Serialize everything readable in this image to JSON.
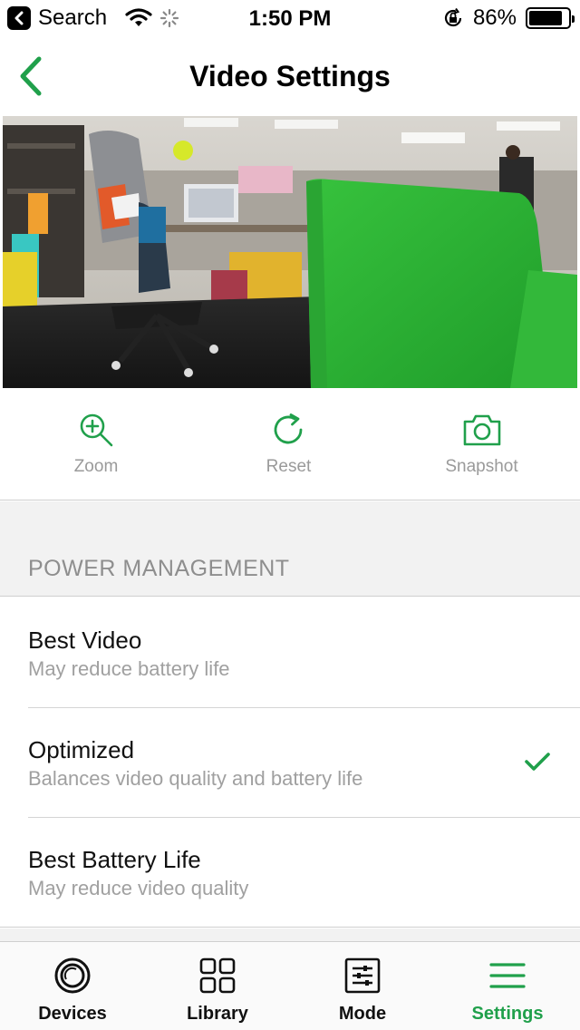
{
  "colors": {
    "accent": "#20a04b",
    "muted_text": "#9a9a9a",
    "section_bg": "#f2f2f2"
  },
  "status_bar": {
    "back_app_label": "Search",
    "time": "1:50 PM",
    "battery": "86%",
    "battery_level": 0.86
  },
  "nav": {
    "title": "Video Settings",
    "back_icon": "chevron-left-icon"
  },
  "camera": {
    "alt": "Live camera view"
  },
  "actions": [
    {
      "label": "Zoom",
      "icon": "zoom-in-icon"
    },
    {
      "label": "Reset",
      "icon": "refresh-icon"
    },
    {
      "label": "Snapshot",
      "icon": "camera-icon"
    }
  ],
  "power_management": {
    "header": "POWER MANAGEMENT",
    "options": [
      {
        "title": "Best Video",
        "subtitle": "May reduce battery life",
        "selected": false
      },
      {
        "title": "Optimized",
        "subtitle": "Balances video quality and battery life",
        "selected": true
      },
      {
        "title": "Best Battery Life",
        "subtitle": "May reduce video quality",
        "selected": false
      }
    ]
  },
  "tabs": [
    {
      "label": "Devices",
      "icon": "devices-icon",
      "active": false
    },
    {
      "label": "Library",
      "icon": "library-icon",
      "active": false
    },
    {
      "label": "Mode",
      "icon": "mode-icon",
      "active": false
    },
    {
      "label": "Settings",
      "icon": "settings-menu-icon",
      "active": true
    }
  ]
}
